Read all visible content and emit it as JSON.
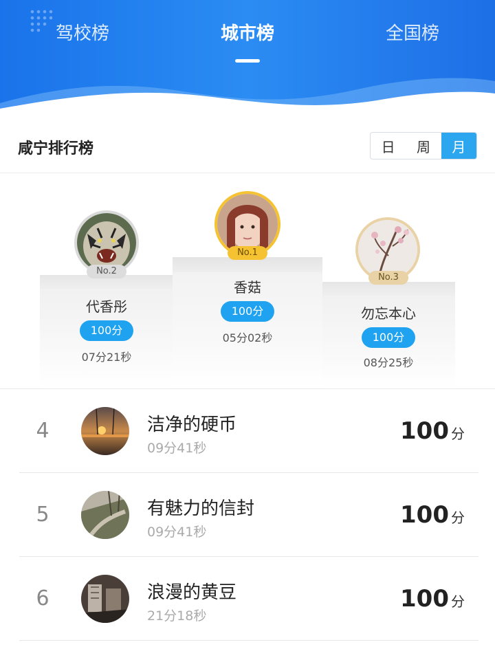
{
  "tabs": [
    {
      "label": "驾校榜",
      "active": false
    },
    {
      "label": "城市榜",
      "active": true
    },
    {
      "label": "全国榜",
      "active": false
    }
  ],
  "section": {
    "title": "咸宁排行榜",
    "periods": [
      "日",
      "周",
      "月"
    ],
    "active_period": "月"
  },
  "podium": {
    "first": {
      "rank": "No.1",
      "name": "香菇",
      "score": "100分",
      "time": "05分02秒"
    },
    "second": {
      "rank": "No.2",
      "name": "代香彤",
      "score": "100分",
      "time": "07分21秒"
    },
    "third": {
      "rank": "No.3",
      "name": "勿忘本心",
      "score": "100分",
      "time": "08分25秒"
    }
  },
  "list": [
    {
      "rank": "4",
      "name": "洁净的硬币",
      "time": "09分41秒",
      "score": "100",
      "unit": "分"
    },
    {
      "rank": "5",
      "name": "有魅力的信封",
      "time": "09分41秒",
      "score": "100",
      "unit": "分"
    },
    {
      "rank": "6",
      "name": "浪漫的黄豆",
      "time": "21分18秒",
      "score": "100",
      "unit": "分"
    }
  ],
  "colors": {
    "header_blue": "#1a73ea",
    "accent": "#1fa3f0",
    "gold_ring": "#f5c232",
    "silver_ring": "#d9d9d9",
    "bronze_ring": "#e8d2a6"
  }
}
